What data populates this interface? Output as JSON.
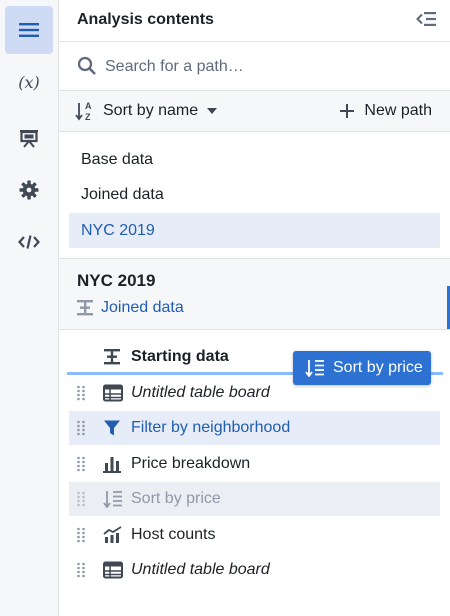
{
  "rail": {
    "items": [
      {
        "name": "contents",
        "icon": "list-icon",
        "active": true
      },
      {
        "name": "variables",
        "icon": "variable-icon",
        "label": "(x)",
        "active": false
      },
      {
        "name": "presentation",
        "icon": "presentation-icon",
        "active": false
      },
      {
        "name": "settings",
        "icon": "gear-icon",
        "active": false
      },
      {
        "name": "code",
        "icon": "code-icon",
        "active": false
      }
    ]
  },
  "header": {
    "title": "Analysis contents",
    "collapse_icon": "collapse-panel-icon"
  },
  "search": {
    "placeholder": "Search for a path…",
    "value": ""
  },
  "toolbar": {
    "sort_label": "Sort by name",
    "new_path_label": "New path"
  },
  "paths": [
    {
      "label": "Base data",
      "selected": false
    },
    {
      "label": "Joined data",
      "selected": false
    },
    {
      "label": "NYC 2019",
      "selected": true
    }
  ],
  "detail": {
    "title": "NYC 2019",
    "parent_label": "Joined data"
  },
  "steps": [
    {
      "label": "Starting data",
      "icon": "merge-icon",
      "style": "start"
    },
    {
      "label": "Untitled table board",
      "icon": "table-icon",
      "style": "italic"
    },
    {
      "label": "Filter by neighborhood",
      "icon": "filter-icon",
      "style": "highlighted"
    },
    {
      "label": "Price breakdown",
      "icon": "bar-chart-icon",
      "style": "normal"
    },
    {
      "label": "Sort by price",
      "icon": "sort-icon",
      "style": "ghost"
    },
    {
      "label": "Host counts",
      "icon": "trend-chart-icon",
      "style": "normal"
    },
    {
      "label": "Untitled table board",
      "icon": "table-icon",
      "style": "italic"
    }
  ],
  "drag": {
    "label": "Sort by price",
    "icon": "sort-icon"
  },
  "colors": {
    "accent": "#2d72d2",
    "selected_bg": "#e7edf8",
    "rail_active_bg": "#cfdbf4"
  }
}
